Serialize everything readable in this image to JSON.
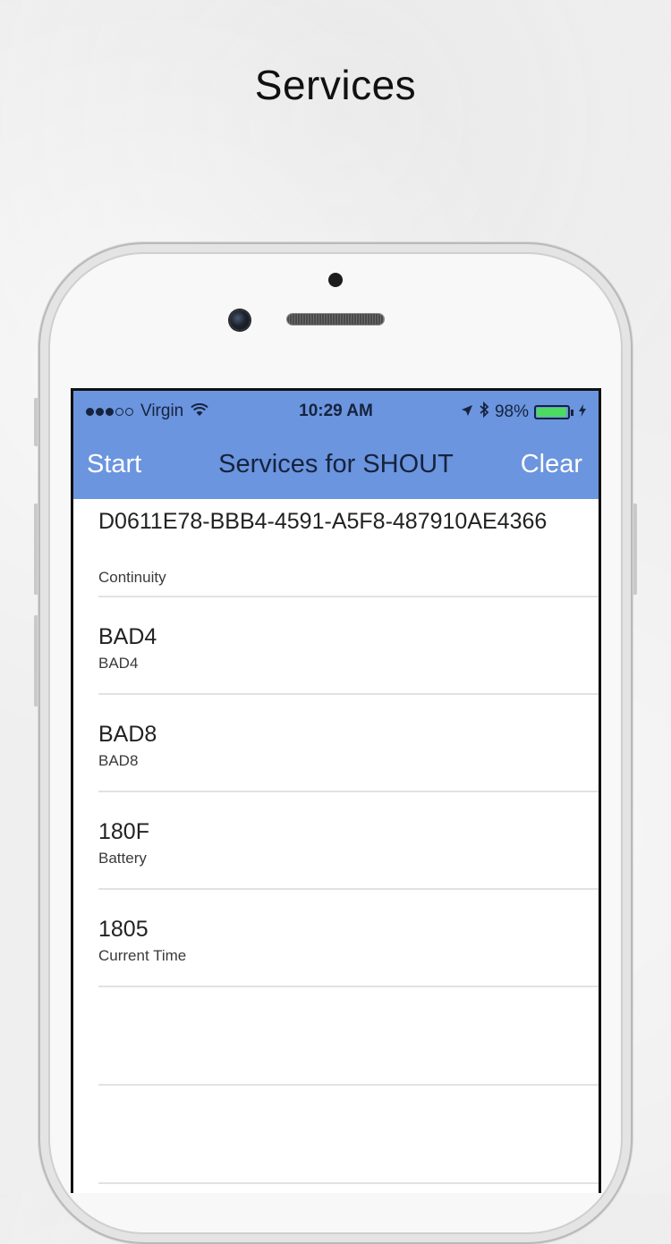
{
  "page": {
    "heading": "Services"
  },
  "status_bar": {
    "carrier": "Virgin",
    "time": "10:29 AM",
    "battery_percent": "98%",
    "battery_level": 0.98,
    "signal_bars": 3,
    "signal_max": 5,
    "icons": [
      "wifi-icon",
      "location-arrow-icon",
      "bluetooth-icon",
      "battery-icon",
      "charging-icon"
    ]
  },
  "nav": {
    "left_label": "Start",
    "title": "Services for SHOUT",
    "right_label": "Clear"
  },
  "colors": {
    "header_background": "#6b95de",
    "nav_button_text": "#ffffff",
    "battery_fill": "#4cd964"
  },
  "services": [
    {
      "uuid": "D0611E78-BBB4-4591-A5F8-487910AE4366",
      "name": "Continuity"
    },
    {
      "uuid": "BAD4",
      "name": "BAD4"
    },
    {
      "uuid": "BAD8",
      "name": "BAD8"
    },
    {
      "uuid": "180F",
      "name": "Battery"
    },
    {
      "uuid": "1805",
      "name": "Current Time"
    }
  ]
}
